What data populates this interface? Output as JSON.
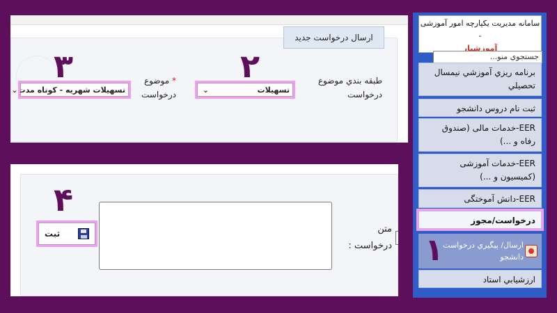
{
  "top_form": {
    "tab_label": "ارسال درخواست جدید",
    "step2_number": "۲",
    "step3_number": "۳",
    "category_label_line1": "طبقه بندي موضوع",
    "category_label_line2": "درخواست",
    "category_value": "تسهيلات",
    "subject_required": "*",
    "subject_label_line1": "موضوع",
    "subject_label_line2": "درخواست",
    "subject_value": "تسهيلات شهريه - کوتاه مدت",
    "chevron": "⌄"
  },
  "bottom_form": {
    "step4_number": "۴",
    "text_label_line1": "متن",
    "text_label_line2": "درخواست :",
    "textarea_value": "",
    "save_label": "ثبت"
  },
  "sidebar": {
    "header_title": "سامانه مديريت يکپارچه امور آموزشی -",
    "header_subtitle": "آموزشيار",
    "search_placeholder": "جستجوي منو...",
    "items": [
      {
        "label": "برنامه ريزي آموزشي نيمسال تحصيلي"
      },
      {
        "label": "ثبت نام دروس دانشجو"
      },
      {
        "label": "EER-خدمات مالی (صندوق رفاه و ...)"
      },
      {
        "label": "EER-خدمات آموزشی (کميسيون و ...)"
      },
      {
        "label": "EER-دانش آموختگی"
      },
      {
        "label": "درخواست/مجوز"
      },
      {
        "label": "ارزشيابي استاد"
      }
    ],
    "submenu_label": "ارسال/ پيگيري درخواست دانشجو",
    "step1_number": "۱"
  },
  "colors": {
    "background": "#5e0f5c",
    "highlight": "#f09ef4",
    "sidebar_blue": "#2f5cc7"
  }
}
